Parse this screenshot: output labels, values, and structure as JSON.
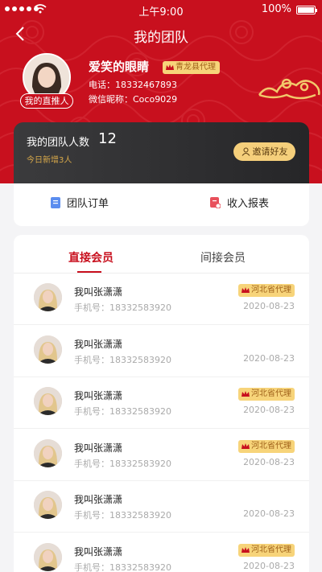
{
  "status_bar": {
    "time": "上午9:00",
    "battery": "100%"
  },
  "nav": {
    "title": "我的团队"
  },
  "profile": {
    "name": "爱笑的眼睛",
    "badge": "青龙县代理",
    "phone": "电话：18332467893",
    "nickname": "微信昵称：Coco9029",
    "direct_tag": "我的直推人"
  },
  "team": {
    "label": "我的团队人数",
    "count": "12",
    "new_today": "今日新增3人",
    "invite_label": "邀请好友"
  },
  "shortcuts": {
    "orders": "团队订单",
    "income": "收入报表"
  },
  "tabs": {
    "direct": "直接会员",
    "indirect": "间接会员"
  },
  "members": [
    {
      "name": "我叫张潇潇",
      "phone": "手机号：18332583920",
      "badge": "河北省代理",
      "date": "2020-08-23"
    },
    {
      "name": "我叫张潇潇",
      "phone": "手机号：18332583920",
      "badge": "",
      "date": "2020-08-23"
    },
    {
      "name": "我叫张潇潇",
      "phone": "手机号：18332583920",
      "badge": "河北省代理",
      "date": "2020-08-23"
    },
    {
      "name": "我叫张潇潇",
      "phone": "手机号：18332583920",
      "badge": "河北省代理",
      "date": "2020-08-23"
    },
    {
      "name": "我叫张潇潇",
      "phone": "手机号：18332583920",
      "badge": "",
      "date": "2020-08-23"
    },
    {
      "name": "我叫张潇潇",
      "phone": "手机号：18332583920",
      "badge": "河北省代理",
      "date": "2020-08-23"
    }
  ],
  "colors": {
    "brand_red": "#c8101e",
    "gold": "#f7d47a",
    "dark_card": "#2f2f31"
  }
}
